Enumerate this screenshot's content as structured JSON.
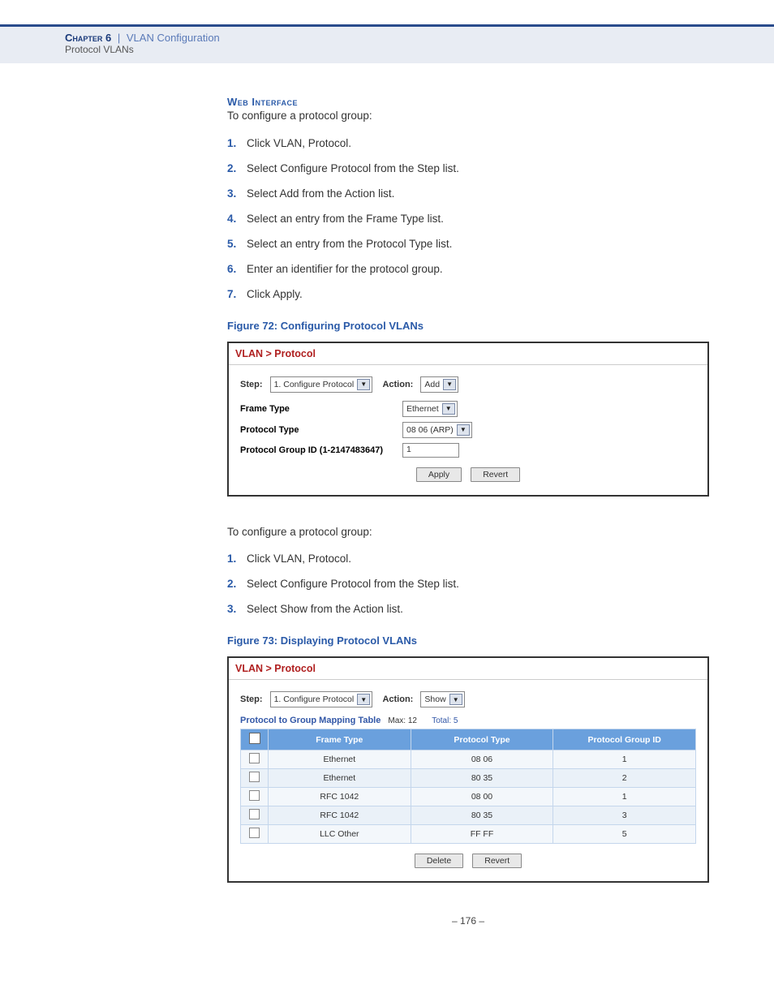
{
  "header": {
    "chapter_label": "Chapter 6",
    "separator": "|",
    "chapter_title": "VLAN Configuration",
    "section": "Protocol VLANs"
  },
  "section_heading": "Web Interface",
  "intro1": "To configure a protocol group:",
  "steps1": [
    "Click VLAN, Protocol.",
    "Select Configure Protocol from the Step list.",
    "Select Add from the Action list.",
    "Select an entry from the Frame Type list.",
    "Select an entry from the Protocol Type list.",
    "Enter an identifier for the protocol group.",
    "Click Apply."
  ],
  "figure72": {
    "caption": "Figure 72:  Configuring Protocol VLANs",
    "crumb": "VLAN > Protocol",
    "step_label": "Step:",
    "step_value": "1. Configure Protocol",
    "action_label": "Action:",
    "action_value": "Add",
    "frame_type_label": "Frame Type",
    "frame_type_value": "Ethernet",
    "protocol_type_label": "Protocol Type",
    "protocol_type_value": "08 06 (ARP)",
    "group_id_label": "Protocol Group ID (1-2147483647)",
    "group_id_value": "1",
    "apply_btn": "Apply",
    "revert_btn": "Revert"
  },
  "intro2": "To configure a protocol group:",
  "steps2": [
    "Click VLAN, Protocol.",
    "Select Configure Protocol from the Step list.",
    "Select Show from the Action list."
  ],
  "figure73": {
    "caption": "Figure 73:  Displaying Protocol VLANs",
    "crumb": "VLAN > Protocol",
    "step_label": "Step:",
    "step_value": "1. Configure Protocol",
    "action_label": "Action:",
    "action_value": "Show",
    "table_title": "Protocol to Group Mapping Table",
    "table_max_label": "Max: 12",
    "table_total_label": "Total: 5",
    "columns": [
      "Frame Type",
      "Protocol Type",
      "Protocol Group ID"
    ],
    "rows": [
      {
        "frame": "Ethernet",
        "ptype": "08 06",
        "gid": "1"
      },
      {
        "frame": "Ethernet",
        "ptype": "80 35",
        "gid": "2"
      },
      {
        "frame": "RFC 1042",
        "ptype": "08 00",
        "gid": "1"
      },
      {
        "frame": "RFC 1042",
        "ptype": "80 35",
        "gid": "3"
      },
      {
        "frame": "LLC Other",
        "ptype": "FF FF",
        "gid": "5"
      }
    ],
    "delete_btn": "Delete",
    "revert_btn": "Revert"
  },
  "page_number": "–  176  –"
}
